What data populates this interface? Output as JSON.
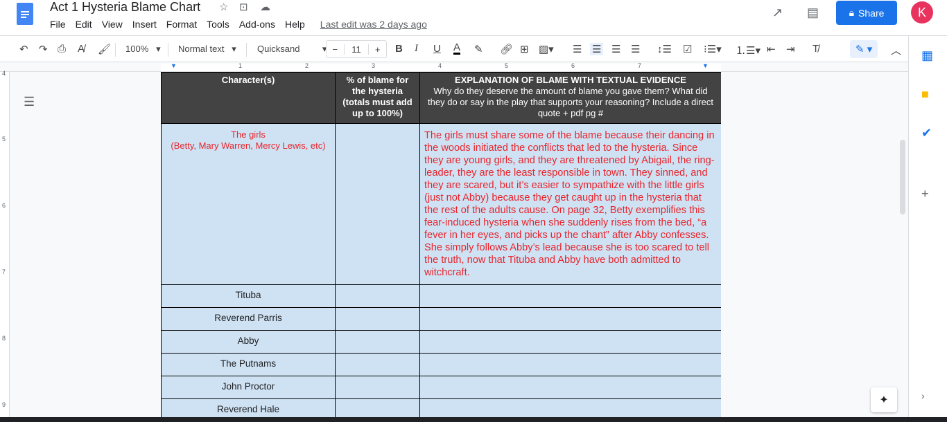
{
  "app": {
    "title": "Act 1  Hysteria Blame Chart",
    "menu": [
      "File",
      "Edit",
      "View",
      "Insert",
      "Format",
      "Tools",
      "Add-ons",
      "Help"
    ],
    "last_edit": "Last edit was 2 days ago",
    "share_label": "Share",
    "avatar_letter": "K"
  },
  "toolbar": {
    "zoom": "100%",
    "style": "Normal text",
    "font": "Quicksand",
    "font_size": "11",
    "minus": "−",
    "plus": "+"
  },
  "ruler": {
    "h": [
      "1",
      "2",
      "3",
      "4",
      "5",
      "6",
      "7"
    ],
    "v": [
      "4",
      "5",
      "6",
      "7",
      "8",
      "9"
    ]
  },
  "table": {
    "headers": {
      "col1": "Character(s)",
      "col2": "% of blame for the hysteria (totals must add up to 100%)",
      "col3_title": "EXPLANATION OF BLAME WITH TEXTUAL EVIDENCE",
      "col3_sub": "Why do they deserve the amount of blame you gave them? What did they do or say in the play that supports your reasoning? Include a direct quote + pdf pg #"
    },
    "girls": {
      "name": "The girls",
      "detail": "(Betty, Mary Warren, Mercy Lewis, etc)",
      "percent": "",
      "explanation": "The girls must share some of the blame because their dancing in the woods initiated the conflicts that led to the hysteria. Since they are young girls, and they are threatened by Abigail, the ring-leader, they are the least responsible in town. They sinned, and they are scared, but it’s easier to sympathize with the little girls (just not Abby) because they get caught up in the hysteria that the rest of the adults cause. On page 32, Betty exemplifies this fear-induced hysteria when she suddenly rises from the bed, “a fever in her eyes, and picks up the chant” after Abby confesses. She simply follows Abby’s lead because she is too scared to tell the truth, now that Tituba and Abby have both admitted to witchcraft."
    },
    "rows": [
      "Tituba",
      "Reverend Parris",
      "Abby",
      "The Putnams",
      "John Proctor",
      "Reverend Hale"
    ]
  },
  "colors": {
    "accent": "#1a73e8",
    "header_bg": "#434343",
    "cell_bg": "#cfe2f3",
    "red_text": "#e8242c"
  }
}
